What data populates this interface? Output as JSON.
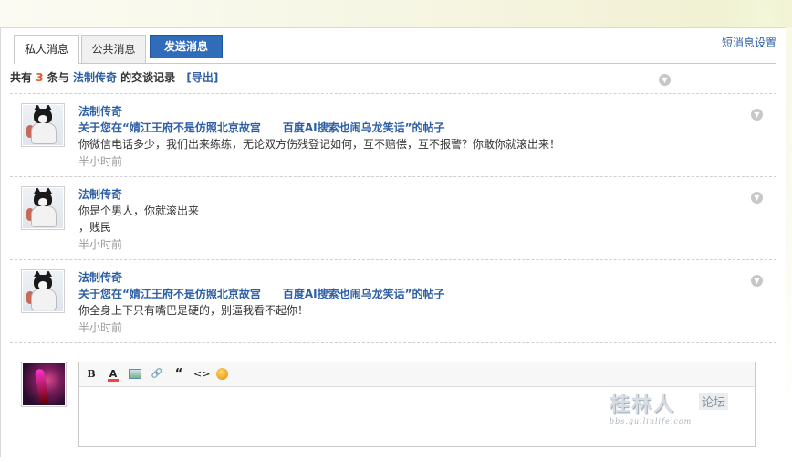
{
  "tabs": {
    "private": "私人消息",
    "public": "公共消息",
    "send": "发送消息",
    "settings": "短消息设置"
  },
  "summary": {
    "prefix": "共有",
    "count": "3",
    "middle": "条与",
    "partner": "法制传奇",
    "suffix": "的交谈记录",
    "export": "[导出]"
  },
  "messages": [
    {
      "author": "法制传奇",
      "subject": "关于您在“婧江王府不是仿照北京故宫　　百度AI搜索也闹乌龙笑话”的帖子",
      "body": "你微信电话多少，我们出来练练，无论双方伤残登记如何，互不赔偿，互不报警？你敢你就滚出来！",
      "time": "半小时前"
    },
    {
      "author": "法制传奇",
      "line1": "你是个男人，你就滚出来",
      "line2": "，贱民",
      "time": "半小时前"
    },
    {
      "author": "法制传奇",
      "subject": "关于您在“婧江王府不是仿照北京故宫　　百度AI搜索也闹乌龙笑话”的帖子",
      "body": "你全身上下只有嘴巴是硬的，别逼我看不起你！",
      "time": "半小时前"
    }
  ],
  "editor": {
    "toolbar": {
      "bold": "B",
      "color": "A",
      "link": "🔗",
      "quote": "“",
      "code": "<>"
    }
  },
  "watermark": {
    "main": "桂林人",
    "sub": "论坛",
    "small": "bbs.guilinlife.com"
  }
}
